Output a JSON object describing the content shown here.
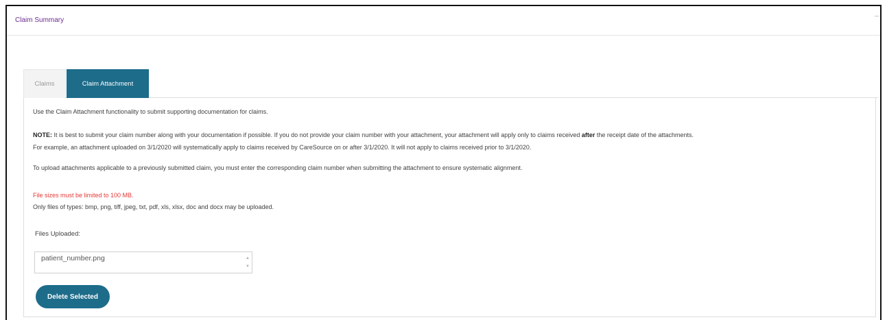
{
  "panel": {
    "title": "Claim Summary"
  },
  "tabs": [
    {
      "label": "Claims",
      "active": false
    },
    {
      "label": "Claim Attachment",
      "active": true
    }
  ],
  "attachment": {
    "intro": "Use the Claim Attachment functionality to submit supporting documentation for claims.",
    "note": {
      "label": "NOTE:",
      "text_before": " It is best to submit your claim number along with your documentation if possible. If you do not provide your claim number with your attachment, your attachment will apply only to claims received ",
      "emphasis": "after",
      "text_after": " the receipt date of the attachments.",
      "example": "For example, an attachment uploaded on 3/1/2020 will systematically apply to claims received by CareSource on or after 3/1/2020. It will not apply to claims received prior to 3/1/2020."
    },
    "upload_instructions": "To upload attachments applicable to a previously submitted claim, you must enter the corresponding claim number when submitting the attachment to ensure systematic alignment.",
    "size_limit": "File sizes must be limited to 100 MB.",
    "allowed_types": "Only files of types: bmp, png, tiff, jpeg, txt, pdf, xls, xlsx, doc and docx may be uploaded.",
    "files_label": "Files Uploaded:",
    "files": [
      "patient_number.png"
    ],
    "delete_button": "Delete Selected"
  },
  "colors": {
    "title": "#6b2c8f",
    "active_tab": "#1d6c8a",
    "warning": "#e53935",
    "button": "#1d6c8a"
  },
  "icons": {
    "scroll_up": "scroll-up-icon",
    "scroll_down": "scroll-down-icon"
  }
}
